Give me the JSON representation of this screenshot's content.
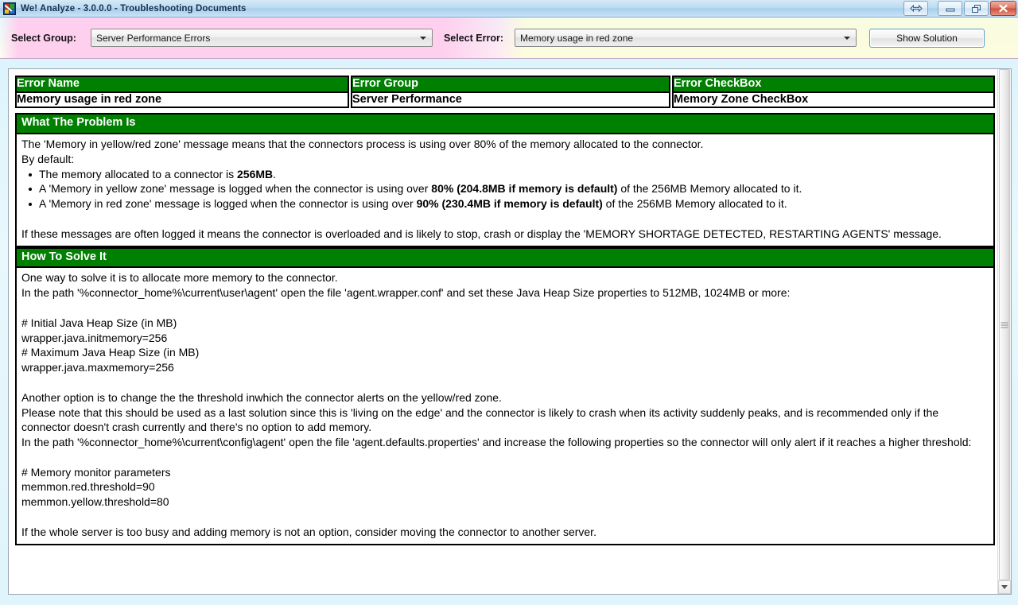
{
  "window": {
    "title": "We! Analyze - 3.0.0.0 - Troubleshooting Documents",
    "buttons": {
      "resize": "resize-window",
      "minimize": "minimize",
      "restore": "restore",
      "close": "close"
    }
  },
  "toolbar": {
    "group_label": "Select Group:",
    "group_value": "Server Performance Errors",
    "error_label": "Select Error:",
    "error_value": "Memory usage in red zone",
    "show_solution_label": "Show Solution"
  },
  "document": {
    "columns": [
      {
        "header": "Error Name",
        "value": "Memory usage in red zone"
      },
      {
        "header": "Error Group",
        "value": "Server Performance"
      },
      {
        "header": "Error CheckBox",
        "value": "Memory Zone CheckBox"
      }
    ],
    "problem": {
      "title": "What The Problem Is",
      "intro_line1": "The 'Memory in yellow/red zone' message means that the connectors process is using over 80% of the memory allocated to the connector.",
      "intro_line2": "By default:",
      "bullets": [
        {
          "pre": "The memory allocated to a connector is ",
          "bold": "256MB",
          "post": "."
        },
        {
          "pre": "A 'Memory in yellow zone' message is logged when the connector is using over ",
          "bold": "80% (204.8MB if memory is default)",
          "post": " of the 256MB Memory allocated to it."
        },
        {
          "pre": "A 'Memory in red zone' message is logged when the connector is using over ",
          "bold": "90% (230.4MB if memory is default)",
          "post": " of the 256MB Memory allocated to it."
        }
      ],
      "closing": "If these messages are often logged it means the connector is overloaded and is likely to stop, crash or display the 'MEMORY SHORTAGE DETECTED, RESTARTING AGENTS' message."
    },
    "solution": {
      "title": "How To Solve It",
      "para1": "One way to solve it is to allocate more memory to the connector.\nIn the path '%connector_home%\\current\\user\\agent' open the file 'agent.wrapper.conf' and set these Java Heap Size properties to 512MB, 1024MB or more:",
      "code1": "# Initial Java Heap Size (in MB)\nwrapper.java.initmemory=256\n# Maximum Java Heap Size (in MB)\nwrapper.java.maxmemory=256",
      "para2": "Another option is to change the the threshold inwhich the connector alerts on the yellow/red zone.\nPlease note that this should be used as a last solution since this is 'living on the edge' and the connector is likely to crash when its activity suddenly peaks, and is recommended only if the connector doesn't crash currently and there's no option to add memory.\nIn the path '%connector_home%\\current\\config\\agent' open the file 'agent.defaults.properties' and increase the following properties so the connector will only alert if it reaches a higher threshold:",
      "code2": "# Memory monitor parameters\nmemmon.red.threshold=90\nmemmon.yellow.threshold=80",
      "para3": "If the whole server is too busy and adding memory is not an option, consider moving the connector to another server."
    }
  },
  "colors": {
    "header_green": "#008000",
    "header_text": "#ffffff",
    "toolbar_pink": "#ffceee",
    "toolbar_yellow": "#fdfdd8"
  }
}
